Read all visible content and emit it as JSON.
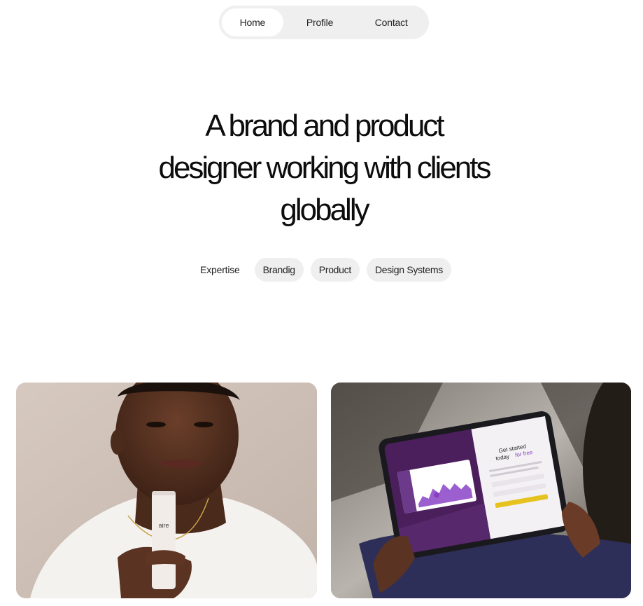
{
  "nav": {
    "items": [
      {
        "label": "Home",
        "active": true
      },
      {
        "label": "Profile",
        "active": false
      },
      {
        "label": "Contact",
        "active": false
      }
    ]
  },
  "hero": {
    "line1": "A brand and product",
    "line2": "designer working with clients",
    "line3": "globally"
  },
  "expertise": {
    "label": "Expertise",
    "tags": [
      "Brandig",
      "Product",
      "Design Systems"
    ]
  },
  "projects": {
    "left": {
      "product_text": "aire"
    },
    "right": {
      "screen_heading_1": "Get started",
      "screen_heading_2": "today",
      "screen_heading_accent": "for free"
    }
  },
  "colors": {
    "nav_bg": "#efefef",
    "tag_bg": "#efefef",
    "screen_purple": "#4a1f5c",
    "accent_yellow": "#e6c21f"
  }
}
